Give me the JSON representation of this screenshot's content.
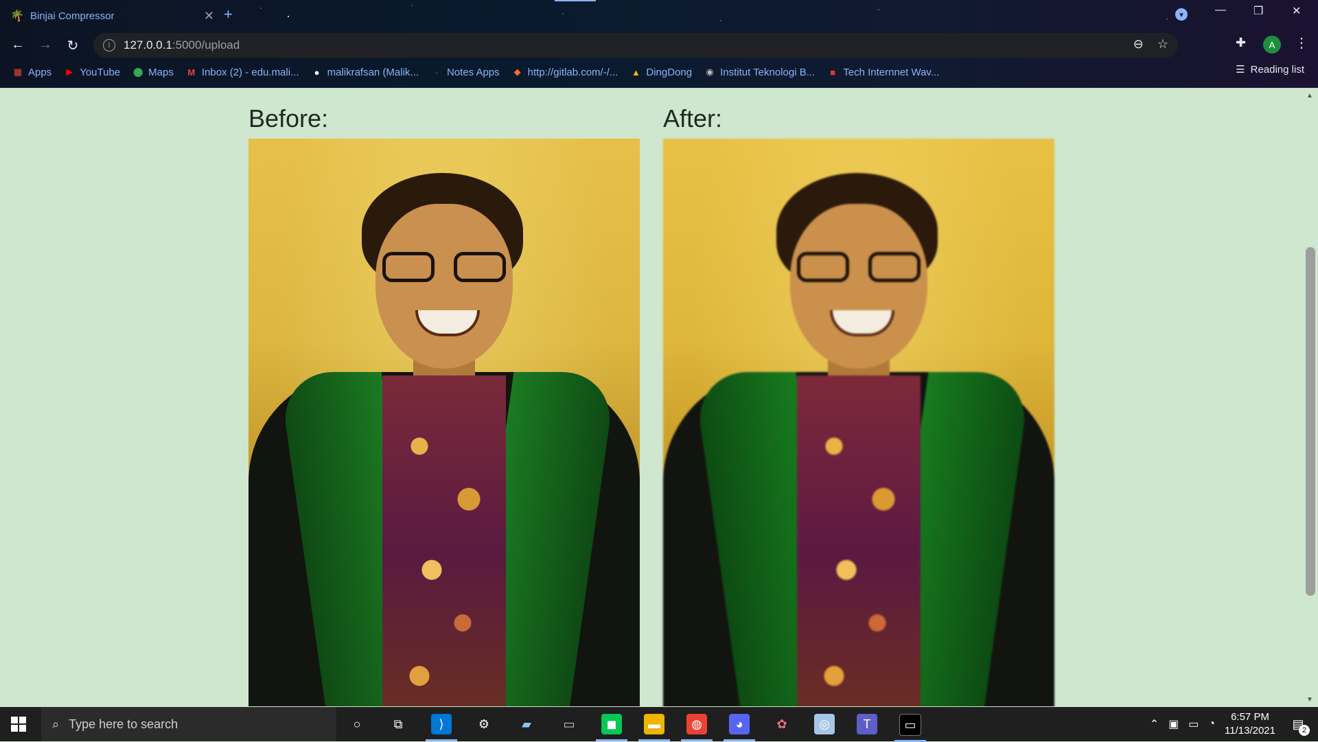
{
  "browser": {
    "tab": {
      "title": "Binjai Compressor",
      "favicon": "palm-tree-icon"
    },
    "url": {
      "host": "127.0.0.1",
      "path": ":5000/upload"
    },
    "bookmarks": [
      {
        "label": "Apps",
        "icon": "apps-grid-icon"
      },
      {
        "label": "YouTube",
        "icon": "youtube-icon"
      },
      {
        "label": "Maps",
        "icon": "maps-pin-icon"
      },
      {
        "label": "Inbox (2) - edu.mali...",
        "icon": "gmail-icon"
      },
      {
        "label": "malikrafsan (Malik...",
        "icon": "github-icon"
      },
      {
        "label": "Notes Apps",
        "icon": "notes-icon"
      },
      {
        "label": "http://gitlab.com/-/...",
        "icon": "gitlab-icon"
      },
      {
        "label": "DingDong",
        "icon": "drive-icon"
      },
      {
        "label": "Institut Teknologi B...",
        "icon": "itb-icon"
      },
      {
        "label": "Tech Internnet Wav...",
        "icon": "tech-icon"
      }
    ],
    "reading_list": "Reading list",
    "avatar_letter": "A",
    "profile_letter": "A"
  },
  "page": {
    "before_label": "Before:",
    "after_label": "After:"
  },
  "taskbar": {
    "search_placeholder": "Type here to search",
    "time": "6:57 PM",
    "date": "11/13/2021",
    "notification_count": "2"
  }
}
